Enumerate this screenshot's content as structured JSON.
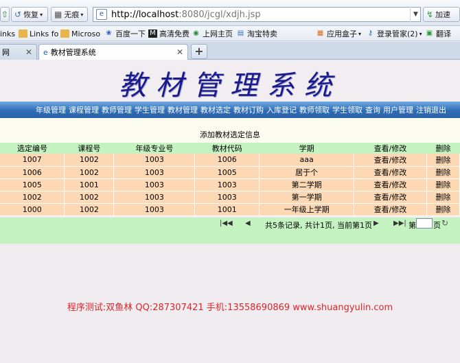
{
  "browser": {
    "back_label": "",
    "restore_label": "恢复",
    "private_label": "无痕",
    "url_host": "http://localhost",
    "url_rest": ":8080/jcgl/xdjh.jsp",
    "accelerate_label": "加速"
  },
  "bookmarks": [
    {
      "label": "inks"
    },
    {
      "label": "Links fo"
    },
    {
      "label": "Microso"
    },
    {
      "label": "百度一下"
    },
    {
      "label": "高清免费"
    },
    {
      "label": "上网主页"
    },
    {
      "label": "淘宝特卖"
    },
    {
      "label": "应用盒子"
    },
    {
      "label": "登录管家(2)"
    },
    {
      "label": "翻译"
    }
  ],
  "tabs": {
    "inactive_label": "网",
    "active_label": "教材管理系统"
  },
  "page": {
    "system_title": "教材管理系统",
    "nav": [
      "年级管理",
      "课程管理",
      "教师管理",
      "学生管理",
      "教材管理",
      "教材选定",
      "教材订购",
      "入库登记",
      "教师领取",
      "学生领取",
      "查询",
      "用户管理",
      "注销退出"
    ],
    "sub_title": "添加教材选定信息",
    "table": {
      "headers": [
        "选定编号",
        "课程号",
        "年级专业号",
        "教材代码",
        "学期",
        "查看/修改",
        "删除"
      ],
      "rows": [
        [
          "1007",
          "1002",
          "1003",
          "1006",
          "aaa",
          "查看/修改",
          "删除"
        ],
        [
          "1006",
          "1002",
          "1003",
          "1005",
          "居于个",
          "查看/修改",
          "删除"
        ],
        [
          "1005",
          "1001",
          "1003",
          "1003",
          "第二学期",
          "查看/修改",
          "删除"
        ],
        [
          "1002",
          "1002",
          "1003",
          "1003",
          "第一学期",
          "查看/修改",
          "删除"
        ],
        [
          "1000",
          "1002",
          "1003",
          "1001",
          "一年级上学期",
          "查看/修改",
          "删除"
        ]
      ]
    },
    "pager": {
      "info": "共5条记录, 共计1页, 当前第1页",
      "di": "第",
      "ye": "页"
    },
    "footer": "程序测试:双鱼林  QQ:287307421  手机:13558690869 www.shuangyulin.com"
  }
}
